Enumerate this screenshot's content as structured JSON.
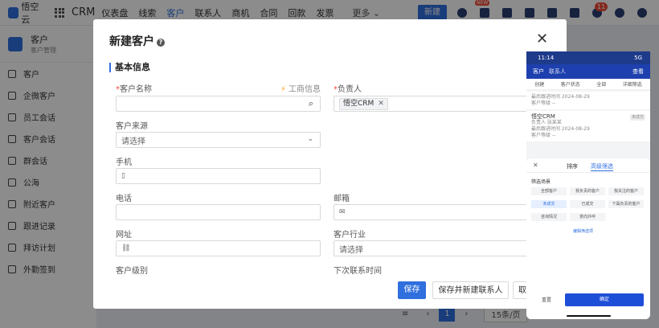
{
  "topbar": {
    "logo": "悟空云",
    "product": "CRM",
    "nav": [
      "仪表盘",
      "线索",
      "客户",
      "联系人",
      "商机",
      "合同",
      "回款",
      "发票"
    ],
    "more": "更多 ⌄",
    "new_button": "新建",
    "new_tag": "NEW",
    "notif_count": "11"
  },
  "sidebar": {
    "title": "客户",
    "subtitle": "客户管理",
    "items": [
      "客户",
      "企微客户",
      "员工会话",
      "客户会话",
      "群会话",
      "公海",
      "附近客户",
      "跟进记录",
      "拜访计划",
      "外勤签到"
    ]
  },
  "pager": {
    "current": "1",
    "size": "15条/页"
  },
  "modal": {
    "title": "新建客户",
    "section": "基本信息",
    "customer_name_label": "客户名称",
    "business_info": "工商信息",
    "owner_label": "负责人",
    "owner_tag": "悟空CRM",
    "source_label": "客户来源",
    "source_placeholder": "请选择",
    "mobile_label": "手机",
    "phone_label": "电话",
    "email_label": "邮箱",
    "website_label": "网址",
    "industry_label": "客户行业",
    "industry_placeholder": "请选择",
    "level_label": "客户级别",
    "next_contact_label": "下次联系时间",
    "save": "保存",
    "save_new_contact": "保存并新建联系人",
    "cancel": "取"
  },
  "phone": {
    "time": "11:14",
    "signal": "5G",
    "title": "客户",
    "owner": "联系人",
    "search": "查看",
    "tabs": [
      "创建",
      "客户状态",
      "全部",
      "详细筛选"
    ],
    "cards": [
      {
        "line1": "最后跟进时间 2024-08-29",
        "line2": "客户等级 --"
      },
      {
        "name": "悟空CRM",
        "line1": "负责人 张某某",
        "line2": "最后跟进时间 2024-08-29",
        "line3": "客户等级 --",
        "tag": "未成交"
      }
    ],
    "sheet": {
      "tab1": "排序",
      "tab2": "高级筛选",
      "label": "筛选场景",
      "chips": [
        "全部客户",
        "我负责的客户",
        "我关注的客户",
        "未成交",
        "已成交",
        "下属负责的客户",
        "咨询情况",
        "意向外呼"
      ],
      "link": "编辑筛选项",
      "reset": "重置",
      "ok": "确定"
    }
  }
}
